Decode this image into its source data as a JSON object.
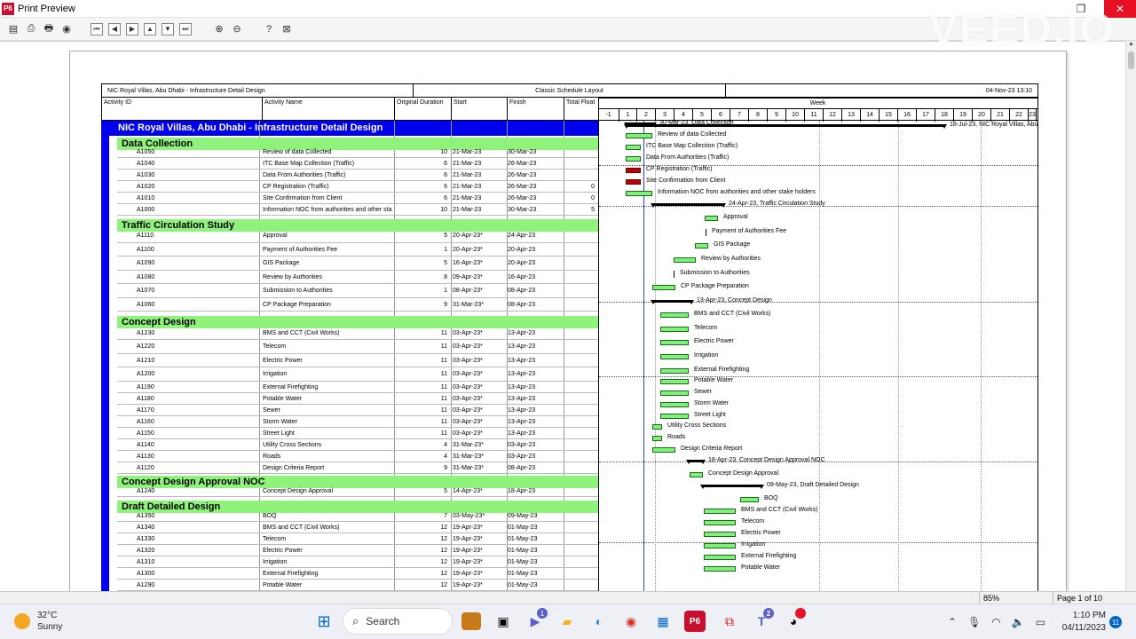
{
  "window": {
    "title": "Print Preview",
    "app_icon": "P6",
    "watermark": "VEED.IO",
    "restore_icon": "restore-icon",
    "close_icon": "close-icon"
  },
  "toolbar": {
    "icons": [
      "page-setup-icon",
      "print-preview-icon",
      "print-icon",
      "publish-icon",
      "first-page-icon",
      "previous-page-icon",
      "next-page-icon",
      "up-icon",
      "down-icon",
      "last-page-icon",
      "zoom-in-icon",
      "zoom-out-icon",
      "help-icon",
      "close-preview-icon"
    ]
  },
  "report": {
    "project_title": "NIC Royal Villas, Abu Dhabi - Infrastructure Detail Design",
    "layout_name": "Classic Schedule Layout",
    "run_date": "04-Nov-23 13:10",
    "columns": {
      "activity_id": "Activity ID",
      "activity_name": "Activity Name",
      "original_duration": "Original Duration",
      "start": "Start",
      "finish": "Finish",
      "total_float": "Total Float"
    },
    "timescale_label": "Week",
    "weeks": [
      "-1",
      "1",
      "2",
      "3",
      "4",
      "5",
      "6",
      "7",
      "8",
      "9",
      "10",
      "11",
      "12",
      "13",
      "14",
      "15",
      "16",
      "17",
      "18",
      "19",
      "20",
      "21",
      "22",
      "23"
    ],
    "project_band": "NIC Royal Villas, Abu Dhabi - Infrastructure Detail Design",
    "project_finish_label": "18-Jul-23, NIC Royal Villas, Abu"
  },
  "wbs": [
    {
      "name": "Data Collection",
      "summary_label": "30-Mar-23, Data Collection"
    },
    {
      "name": "Traffic Circulation Study",
      "summary_label": "24-Apr-23, Traffic Circulation Study"
    },
    {
      "name": "Concept Design",
      "summary_label": "13-Apr-23, Concept Design"
    },
    {
      "name": "Concept Design Approval NOC",
      "summary_label": "18-Apr-23, Concept Design Approval NOC"
    },
    {
      "name": "Draft Detailed Design",
      "summary_label": "09-May-23, Draft Detailed Design"
    }
  ],
  "activities": [
    {
      "id": "A1050",
      "name": "Review of data Collected",
      "dur": "10",
      "start": "21-Mar-23",
      "finish": "30-Mar-23",
      "float": "",
      "bar": "Review of data Collected"
    },
    {
      "id": "A1040",
      "name": "ITC Base Map Collection (Traffic)",
      "dur": "6",
      "start": "21-Mar-23",
      "finish": "26-Mar-23",
      "float": "",
      "bar": "ITC Base Map Collection (Traffic)"
    },
    {
      "id": "A1030",
      "name": "Data From Authorities (Traffic)",
      "dur": "6",
      "start": "21-Mar-23",
      "finish": "26-Mar-23",
      "float": "",
      "bar": "Data From Authorities (Traffic)"
    },
    {
      "id": "A1020",
      "name": "CP Registration (Traffic)",
      "dur": "6",
      "start": "21-Mar-23",
      "finish": "26-Mar-23",
      "float": "0",
      "bar": "CP Registration (Traffic)"
    },
    {
      "id": "A1010",
      "name": "Site Confirmation from Client",
      "dur": "6",
      "start": "21-Mar-23",
      "finish": "26-Mar-23",
      "float": "0",
      "bar": "Site Confirmation from Client"
    },
    {
      "id": "A1000",
      "name": "Information NOC from authorities and other sta",
      "dur": "10",
      "start": "21-Mar-23",
      "finish": "30-Mar-23",
      "float": "5",
      "bar": "Information NOC from authorities and other stake holders"
    },
    {
      "id": "A1110",
      "name": "Approval",
      "dur": "5",
      "start": "20-Apr-23*",
      "finish": "24-Apr-23",
      "float": "",
      "bar": "Approval"
    },
    {
      "id": "A1100",
      "name": "Payment of Authorities Fee",
      "dur": "1",
      "start": "20-Apr-23*",
      "finish": "20-Apr-23",
      "float": "",
      "bar": "Payment of Authorities Fee"
    },
    {
      "id": "A1090",
      "name": "GIS Package",
      "dur": "5",
      "start": "16-Apr-23*",
      "finish": "20-Apr-23",
      "float": "",
      "bar": "GIS Package"
    },
    {
      "id": "A1080",
      "name": "Review by Authorities",
      "dur": "8",
      "start": "09-Apr-23*",
      "finish": "16-Apr-23",
      "float": "",
      "bar": "Review by Authorities"
    },
    {
      "id": "A1070",
      "name": "Submission to Authorities",
      "dur": "1",
      "start": "08-Apr-23*",
      "finish": "08-Apr-23",
      "float": "",
      "bar": "Submission to Authorities"
    },
    {
      "id": "A1060",
      "name": "CP Package Preparation",
      "dur": "9",
      "start": "31-Mar-23*",
      "finish": "08-Apr-23",
      "float": "",
      "bar": "CP Package Preparation"
    },
    {
      "id": "A1230",
      "name": "BMS and CCT (Civil Works)",
      "dur": "11",
      "start": "03-Apr-23*",
      "finish": "13-Apr-23",
      "float": "",
      "bar": "BMS and CCT (Civil Works)"
    },
    {
      "id": "A1220",
      "name": "Telecom",
      "dur": "11",
      "start": "03-Apr-23*",
      "finish": "13-Apr-23",
      "float": "",
      "bar": "Telecom"
    },
    {
      "id": "A1210",
      "name": "Electric Power",
      "dur": "11",
      "start": "03-Apr-23*",
      "finish": "13-Apr-23",
      "float": "",
      "bar": "Electric Power"
    },
    {
      "id": "A1200",
      "name": "Irrigation",
      "dur": "11",
      "start": "03-Apr-23*",
      "finish": "13-Apr-23",
      "float": "",
      "bar": "Irrigation"
    },
    {
      "id": "A1190",
      "name": "External Firefighting",
      "dur": "11",
      "start": "03-Apr-23*",
      "finish": "13-Apr-23",
      "float": "",
      "bar": "External Firefighting"
    },
    {
      "id": "A1180",
      "name": "Potable Water",
      "dur": "11",
      "start": "03-Apr-23*",
      "finish": "13-Apr-23",
      "float": "",
      "bar": "Potable Water"
    },
    {
      "id": "A1170",
      "name": "Sewer",
      "dur": "11",
      "start": "03-Apr-23*",
      "finish": "13-Apr-23",
      "float": "",
      "bar": "Sewer"
    },
    {
      "id": "A1160",
      "name": "Storm Water",
      "dur": "11",
      "start": "03-Apr-23*",
      "finish": "13-Apr-23",
      "float": "",
      "bar": "Storm Water"
    },
    {
      "id": "A1150",
      "name": "Street Light",
      "dur": "11",
      "start": "03-Apr-23*",
      "finish": "13-Apr-23",
      "float": "",
      "bar": "Street Light"
    },
    {
      "id": "A1140",
      "name": "Utility Cross Sections",
      "dur": "4",
      "start": "31-Mar-23*",
      "finish": "03-Apr-23",
      "float": "",
      "bar": "Utility Cross Sections"
    },
    {
      "id": "A1130",
      "name": "Roads",
      "dur": "4",
      "start": "31-Mar-23*",
      "finish": "03-Apr-23",
      "float": "",
      "bar": "Roads"
    },
    {
      "id": "A1120",
      "name": "Design Criteria Report",
      "dur": "9",
      "start": "31-Mar-23*",
      "finish": "08-Apr-23",
      "float": "",
      "bar": "Design Criteria Report"
    },
    {
      "id": "A1240",
      "name": "Concept Design Approval",
      "dur": "5",
      "start": "14-Apr-23*",
      "finish": "18-Apr-23",
      "float": "",
      "bar": "Concept Design Approval"
    },
    {
      "id": "A1350",
      "name": "BOQ",
      "dur": "7",
      "start": "03-May-23*",
      "finish": "09-May-23",
      "float": "",
      "bar": "BOQ"
    },
    {
      "id": "A1340",
      "name": "BMS and CCT (Civil Works)",
      "dur": "12",
      "start": "19-Apr-23*",
      "finish": "01-May-23",
      "float": "",
      "bar": "BMS and CCT (Civil Works)"
    },
    {
      "id": "A1330",
      "name": "Telecom",
      "dur": "12",
      "start": "19-Apr-23*",
      "finish": "01-May-23",
      "float": "",
      "bar": "Telecom"
    },
    {
      "id": "A1320",
      "name": "Electric Power",
      "dur": "12",
      "start": "19-Apr-23*",
      "finish": "01-May-23",
      "float": "",
      "bar": "Electric Power"
    },
    {
      "id": "A1310",
      "name": "Irrigation",
      "dur": "12",
      "start": "19-Apr-23*",
      "finish": "01-May-23",
      "float": "",
      "bar": "Irrigation"
    },
    {
      "id": "A1300",
      "name": "External Firefighting",
      "dur": "12",
      "start": "19-Apr-23*",
      "finish": "01-May-23",
      "float": "",
      "bar": "External Firefighting"
    },
    {
      "id": "A1290",
      "name": "Potable Water",
      "dur": "12",
      "start": "19-Apr-23*",
      "finish": "01-May-23",
      "float": "",
      "bar": "Potable Water"
    }
  ],
  "status": {
    "zoom": "85%",
    "page": "Page 1 of 10"
  },
  "taskbar": {
    "temperature": "32°C",
    "weather": "Sunny",
    "search_placeholder": "Search",
    "time": "1:10 PM",
    "date": "04/11/2023",
    "notification_count": "11",
    "teams_badge": "2"
  },
  "colors": {
    "project_band": "#0000ee",
    "wbs_band": "#8ff27a",
    "bar_normal": "#7ff07a",
    "bar_critical": "#c00000"
  }
}
